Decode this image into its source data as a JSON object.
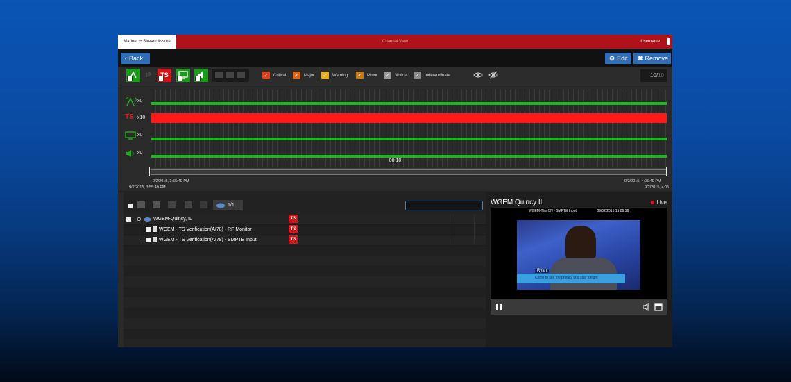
{
  "titlebar": {
    "product": "Mariner™ Stream Assure",
    "window_title": "Channel View",
    "user": "Username"
  },
  "actions": {
    "back_label": "Back",
    "edit_label": "Edit",
    "remove_label": "Remove"
  },
  "filter": {
    "ip_label": "IP",
    "ts_label": "TS",
    "severities": [
      {
        "label": "Critical",
        "color": "#e0401a"
      },
      {
        "label": "Major",
        "color": "#e0671a"
      },
      {
        "label": "Warning",
        "color": "#e8b020"
      },
      {
        "label": "Minor",
        "color": "#c87a18"
      },
      {
        "label": "Notice",
        "color": "#9a9a9a"
      },
      {
        "label": "Indeterminate",
        "color": "#8a8a8a"
      }
    ],
    "counter_value": "10/",
    "counter_total": "10"
  },
  "timeline": {
    "lanes": [
      {
        "name": "ip",
        "icon": "ip-signal-icon",
        "count": "x0",
        "status_color": "#1cb81c"
      },
      {
        "name": "ts",
        "icon": "ts-icon",
        "icon_text": "TS",
        "count": "x10",
        "status_color": "#ff1a1a"
      },
      {
        "name": "video",
        "icon": "monitor-icon",
        "count": "x0",
        "status_color": "#1cb81c"
      },
      {
        "name": "audio",
        "icon": "speaker-icon",
        "count": "x0",
        "status_color": "#1cb81c"
      }
    ],
    "window_label": "00:10",
    "start_upper": "9/2/2015, 3:55:49 PM",
    "start_lower": "9/2/2015, 3:55:49 PM",
    "end_upper": "9/2/2015, 4:05:49 PM",
    "end_lower": "9/2/2015, 4:05"
  },
  "tree": {
    "pager": "1/1",
    "search_placeholder": "",
    "rows": [
      {
        "label": "WGEM-Quincy, IL",
        "badge": "TS"
      },
      {
        "label": "WGEM - TS Verification(A/78) - RF Monitor",
        "badge": "TS"
      },
      {
        "label": "WGEM - TS Verification(A/78) - SMPTE Input",
        "badge": "TS"
      }
    ]
  },
  "video": {
    "title": "WGEM Quincy IL",
    "live_label": "Live",
    "caption_left": "WGEM-The CN - SMPTE Input",
    "caption_right": "09/02/2015 15:06:16",
    "lower_third_name": "Ryan",
    "lower_third_text": "Come to see me privacy and stay tonight"
  }
}
